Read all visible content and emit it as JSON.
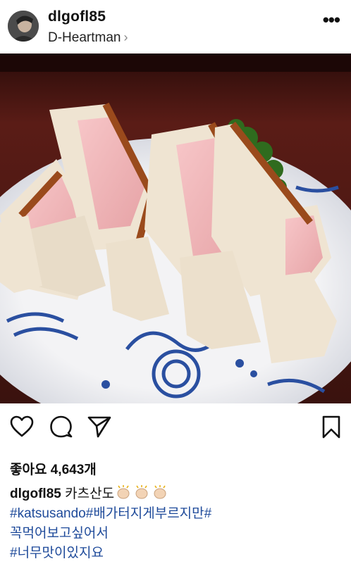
{
  "post": {
    "username": "dlgofl85",
    "location": "D-Heartman",
    "location_chevron": "›",
    "more_glyph": "•••"
  },
  "photo": {
    "subject": "katsu sando on plate"
  },
  "icons": {
    "like": "heart-icon",
    "comment": "comment-icon",
    "share": "send-icon",
    "save": "bookmark-icon"
  },
  "likes": {
    "text": "좋아요 4,643개"
  },
  "caption": {
    "username": "dlgofl85",
    "line1_text": "카츠산도",
    "line2_tag": "#katsusando#배가터지게부르지만#",
    "line3_tag": "꼭먹어보고싶어서",
    "line4_tag": "#너무맛이있지요"
  },
  "colors": {
    "hashtag": "#1e4a9a",
    "text": "#111111"
  }
}
